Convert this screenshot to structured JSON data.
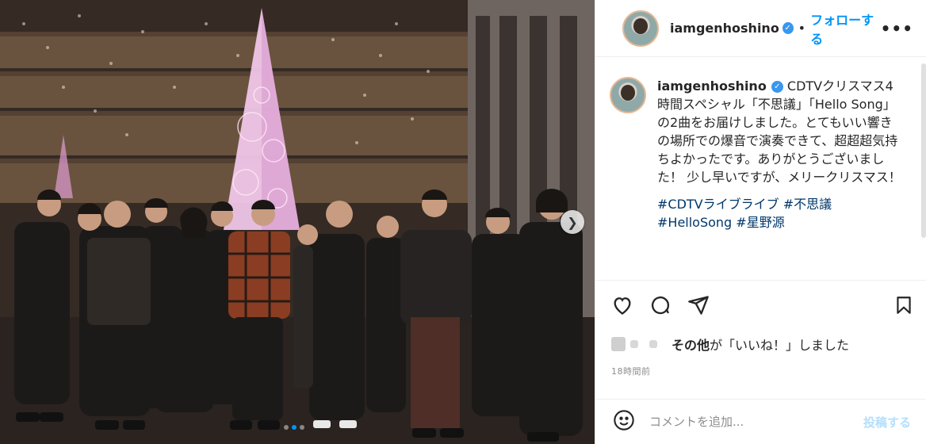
{
  "post": {
    "username": "iamgenhoshino",
    "follow_label": "フォローする",
    "separator": "•",
    "more_label": "•••",
    "caption": "CDTVクリスマス4時間スペシャル「不思議」「Hello Song」の2曲をお届けしました。とてもいい響きの場所での爆音で演奏できて、超超超気持ちよかったです。ありがとうございました！ 少し早いですが、メリークリスマス！",
    "hashtags": "#CDTVライブライブ #不思議 #HelloSong #星野源",
    "likes_suffix": "その他",
    "likes_text": "が「いいね！」しました",
    "timestamp": "18時間前",
    "comment_placeholder": "コメントを追加...",
    "post_button": "投稿する"
  },
  "carousel": {
    "current": 2,
    "total": 3
  },
  "icons": {
    "like": "heart-icon",
    "comment": "comment-icon",
    "share": "share-icon",
    "save": "bookmark-icon",
    "emoji": "emoji-icon",
    "next": "chevron-right-icon"
  },
  "colors": {
    "accent": "#0095f6",
    "link": "#00376b",
    "muted": "#8e8e8e",
    "post_disabled": "#b2dffc"
  }
}
